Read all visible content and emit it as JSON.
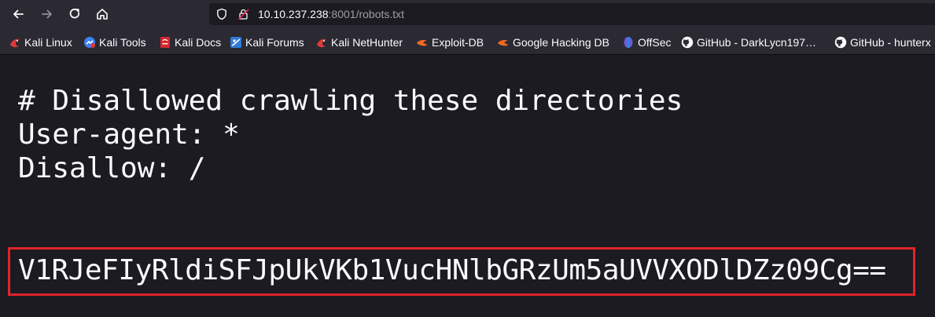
{
  "navigation": {
    "back_icon": "arrow-left-icon",
    "forward_icon": "arrow-right-icon",
    "reload_icon": "reload-icon",
    "home_icon": "home-icon"
  },
  "urlbar": {
    "host": "10.10.237.238",
    "rest": ":8001/robots.txt"
  },
  "bookmarks": [
    {
      "label": "Kali Linux",
      "icon": "kali-dragon-icon"
    },
    {
      "label": "Kali Tools",
      "icon": "kali-tools-icon"
    },
    {
      "label": "Kali Docs",
      "icon": "kali-docs-icon"
    },
    {
      "label": "Kali Forums",
      "icon": "kali-forums-icon"
    },
    {
      "label": "Kali NetHunter",
      "icon": "kali-dragon-icon"
    },
    {
      "label": "Exploit-DB",
      "icon": "exploit-db-icon"
    },
    {
      "label": "Google Hacking DB",
      "icon": "exploit-db-icon"
    },
    {
      "label": "OffSec",
      "icon": "offsec-icon"
    },
    {
      "label": "GitHub - DarkLycn197…",
      "icon": "github-icon"
    },
    {
      "label": "GitHub - hunterx",
      "icon": "github-icon"
    }
  ],
  "page": {
    "lines": [
      "# Disallowed crawling these directories",
      "User-agent: *",
      "Disallow: /"
    ],
    "encoded": "V1RJeFIyRldiSFJpUkVKb1VucHNlbGRzUm5aUVVXODlDZz09Cg=="
  },
  "colors": {
    "highlight_border": "#e0242a",
    "background": "#1c1b22",
    "toolbar": "#2b2a33"
  }
}
